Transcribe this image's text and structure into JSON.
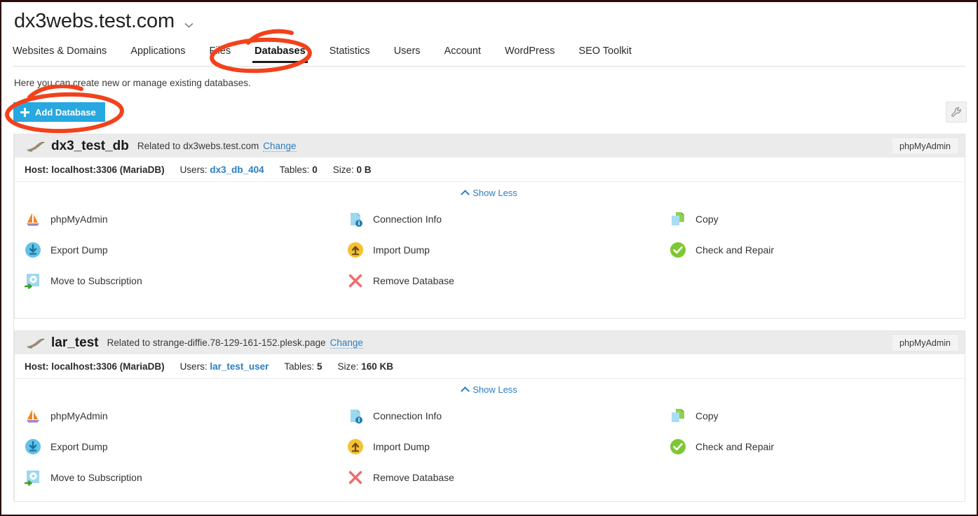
{
  "header": {
    "site_title": "dx3webs.test.com",
    "title_caret_icon": "chevron-down-icon",
    "nav": [
      {
        "label": "Websites & Domains",
        "active": false
      },
      {
        "label": "Applications",
        "active": false
      },
      {
        "label": "Files",
        "active": false
      },
      {
        "label": "Databases",
        "active": true
      },
      {
        "label": "Statistics",
        "active": false
      },
      {
        "label": "Users",
        "active": false
      },
      {
        "label": "Account",
        "active": false
      },
      {
        "label": "WordPress",
        "active": false
      },
      {
        "label": "SEO Toolkit",
        "active": false
      }
    ]
  },
  "toolbar": {
    "intro_text": "Here you can create new or manage existing databases.",
    "add_database_label": "Add Database",
    "add_database_color": "#28a8e0",
    "settings_icon": "wrench-icon"
  },
  "labels": {
    "related_to": "Related to",
    "change": "Change",
    "phpmyadmin_badge": "phpMyAdmin",
    "host": "Host:",
    "users": "Users:",
    "tables": "Tables:",
    "size": "Size:",
    "show_less": "Show Less"
  },
  "actions": [
    {
      "label": "phpMyAdmin",
      "icon": "phpmyadmin-sailboat-icon"
    },
    {
      "label": "Connection Info",
      "icon": "connection-info-icon"
    },
    {
      "label": "Copy",
      "icon": "copy-icon"
    },
    {
      "label": "Export Dump",
      "icon": "export-dump-icon"
    },
    {
      "label": "Import Dump",
      "icon": "import-dump-icon"
    },
    {
      "label": "Check and Repair",
      "icon": "check-and-repair-icon"
    },
    {
      "label": "Move to Subscription",
      "icon": "move-to-subscription-icon"
    },
    {
      "label": "Remove Database",
      "icon": "remove-database-icon"
    }
  ],
  "databases": [
    {
      "name": "dx3_test_db",
      "icon": "mariadb-seal-icon",
      "related_domain": "dx3webs.test.com",
      "host": "localhost:3306 (MariaDB)",
      "user": "dx3_db_404",
      "tables": "0",
      "size": "0 B",
      "expanded": true
    },
    {
      "name": "lar_test",
      "icon": "mariadb-seal-icon",
      "related_domain": "strange-diffie.78-129-161-152.plesk.page",
      "host": "localhost:3306 (MariaDB)",
      "user": "lar_test_user",
      "tables": "5",
      "size": "160 KB",
      "expanded": true
    }
  ],
  "annotations": {
    "color": "#f2421b",
    "shapes": [
      "ellipse-around-databases-tab",
      "ellipse-around-add-database-button"
    ]
  }
}
